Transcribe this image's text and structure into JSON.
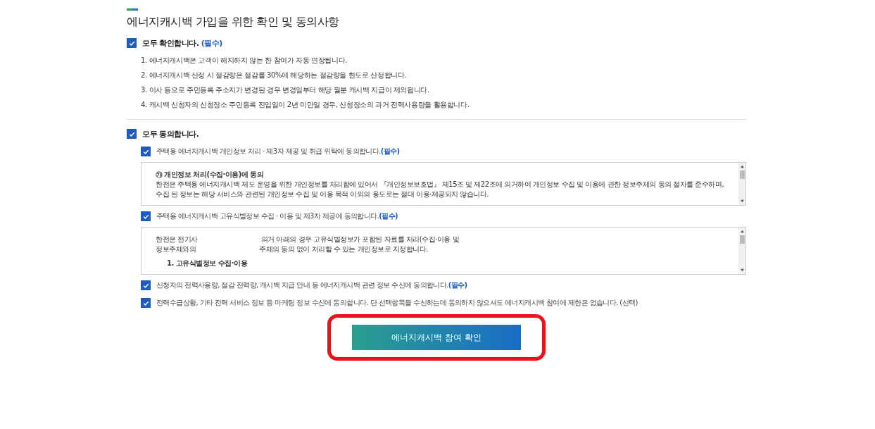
{
  "title": "에너지캐시백 가입을 위한 확인 및 동의사항",
  "confirm_all": {
    "label": "모두 확인합니다.",
    "tag": "(필수)",
    "checked": true
  },
  "notices": [
    "1. 에너지캐시백은 고객이 해지하지 않는 한 참여가 자동 연장됩니다.",
    "2. 에너지캐시백 산정 시 절감량은 절감률 30%에 해당하는 절감량을 한도로 산정합니다.",
    "3. 이사 등으로 주민등록 주소지가 변경된 경우 변경일부터 해당 월분 캐시백 지급이 제외됩니다.",
    "4. 캐시백 신청자의 신청장소 주민등록 전입일이 2년 미만일 경우, 신청장소의 과거 전력사용량을 활용합니다."
  ],
  "agree_all": {
    "label": "모두 동의합니다.",
    "checked": true
  },
  "agreements": [
    {
      "label": "주택용 에너지캐시백 개인정보 처리 · 제3자 제공 및 취급 위탁에 동의합니다.",
      "tag": "(필수)",
      "checked": true,
      "terms": {
        "heading": "㉮ 개인정보 처리(수집·이용)에 동의",
        "lines": [
          [
            "한전은 주택용 에너지캐시백 제도 운영을 위한 개인정보를 처리함에 있어서 『개인정보보호법』 제15조 및 제22조에 의거하여 개인정보 수집 및 이용에 관한 정보주체의 동의 절차를 준수하며, 수집 된 정보는 해당 서비스와 관련된 개인정보 수집 및 이용 목적 이외의 용도로는 절대 이용·제공되지 않습니다."
          ]
        ]
      }
    },
    {
      "label": "주택용 에너지캐시백 고유식별정보 수집 · 이용 및 제3자 제공에 동의합니다.",
      "tag": "(필수)",
      "checked": true,
      "terms": {
        "lines": [
          [
            "한전은 전기사",
            "의거 아래의 경우 고유식별정보가 포함된 자료를 처리(수집·이용 및"
          ],
          [
            "정보주체와의",
            "주체의 동의 없이 처리할 수 있는 개인정보로 지정합니다."
          ]
        ],
        "subheading": "1. 고유식별정보 수집·이용"
      }
    },
    {
      "label": "신청자의 전력사용량, 절감 전력량, 캐시백 지급 안내 등 에너지캐시백 관련 정보 수신에 동의합니다.",
      "tag": "(필수)",
      "checked": true
    },
    {
      "label": "전력수급상황, 기타 전력 서비스 정보 등 마케팅 정보 수신에 동의합니다. 단 선택항목을 수신하는데 동의하지 않으셔도 에너지캐시백 참여에 제한은 없습니다. (선택)",
      "checked": true
    }
  ],
  "submit": {
    "label": "에너지캐시백 참여 확인",
    "highlighted": true
  }
}
